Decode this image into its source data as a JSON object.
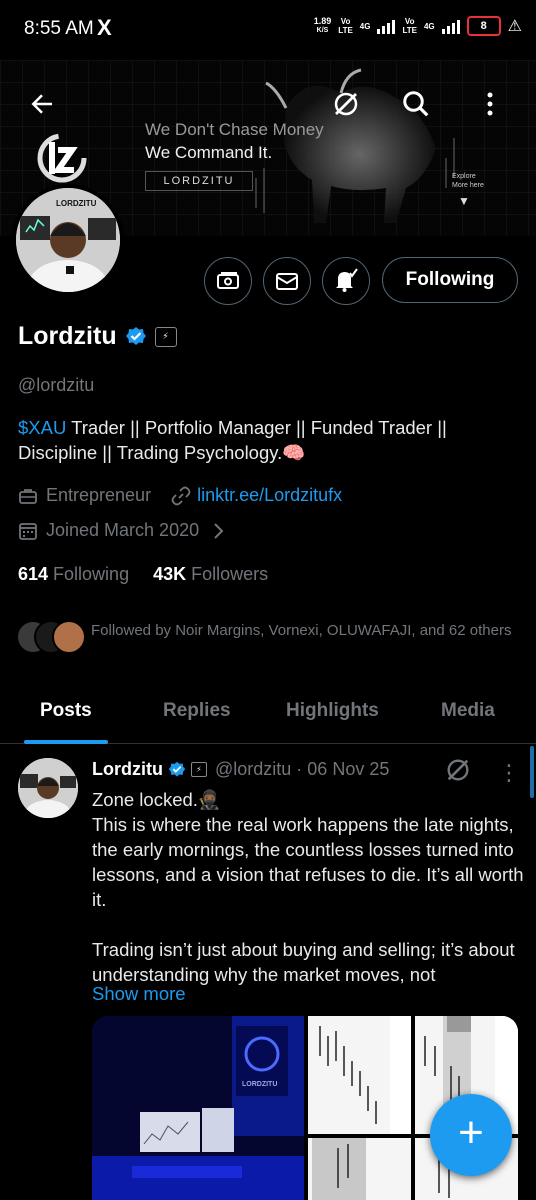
{
  "status_bar": {
    "time": "8:55 AM",
    "app_icon": "X",
    "speed_value": "1.89",
    "speed_unit": "K/S",
    "net1_top": "Vo",
    "net1_bottom": "LTE",
    "net2_top": "4G",
    "net3_top": "Vo",
    "net3_bottom": "LTE",
    "net4_top": "4G",
    "battery": "8"
  },
  "banner": {
    "tagline_1": "We Don't Chase Money",
    "tagline_2": "We Command It.",
    "tag_box": "LORDZITU",
    "explore_line1": "Explore",
    "explore_line2": "More here"
  },
  "profile": {
    "name": "Lordzitu",
    "handle": "@lordzitu",
    "bio_cashtag": "$XAU",
    "bio_rest": " Trader || Portfolio Manager || Funded Trader || Discipline || Trading Psychology.🧠",
    "category": "Entrepreneur",
    "link": "linktr.ee/Lordzitufx",
    "joined": "Joined March 2020",
    "following_count": "614",
    "following_label": "Following",
    "followers_count": "43K",
    "followers_label": "Followers",
    "followed_by": "Followed by Noir Margins, Vornexi, OLUWAFAJI, and 62 others",
    "following_button": "Following"
  },
  "tabs": [
    {
      "label": "Posts",
      "active": true
    },
    {
      "label": "Replies",
      "active": false
    },
    {
      "label": "Highlights",
      "active": false
    },
    {
      "label": "Media",
      "active": false
    }
  ],
  "post": {
    "name": "Lordzitu",
    "handle": "@lordzitu",
    "date": "· 06 Nov 25",
    "text": "Zone locked.🥷🏾\nThis is where the real work happens the late nights, the early mornings, the countless losses turned into lessons, and a vision that refuses to die. It’s all worth it.\n\nTrading isn’t just about buying and selling; it’s about understanding why the market moves, not",
    "show_more": "Show more"
  },
  "fab": {
    "label": "+"
  },
  "colors": {
    "accent": "#1d9bf0",
    "muted": "#71767b",
    "border": "#2f3336",
    "battery_low": "#e8313b"
  },
  "icons": {
    "back": "back-arrow-icon",
    "grok": "grok-icon",
    "search": "search-icon",
    "more": "more-vertical-icon",
    "tip": "money-icon",
    "message": "envelope-icon",
    "notify": "bell-check-icon",
    "category": "briefcase-icon",
    "link": "link-icon",
    "calendar": "calendar-icon",
    "chevron": "chevron-right-icon"
  }
}
